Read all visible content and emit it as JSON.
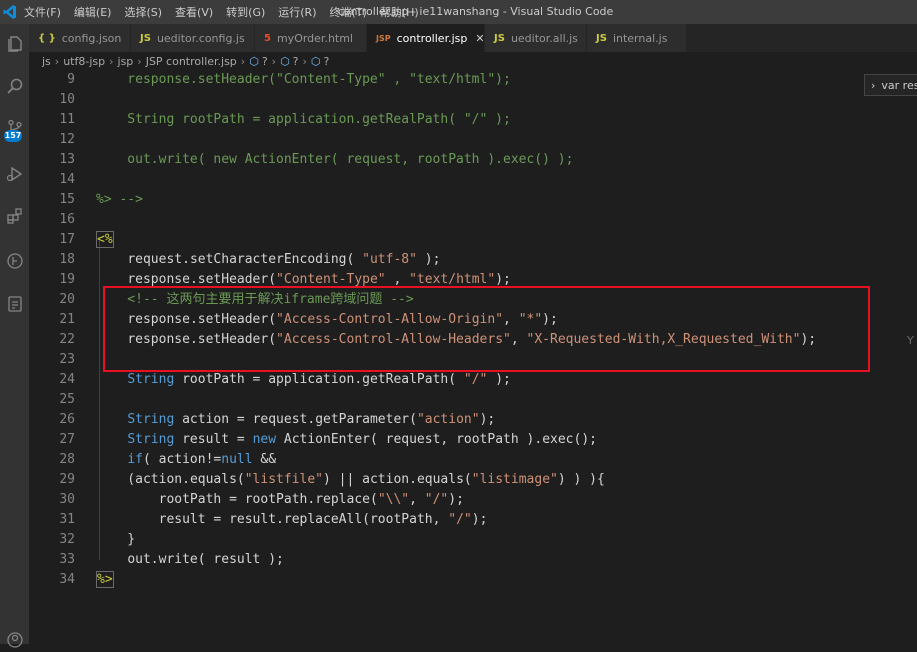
{
  "titlebar": {
    "menu": [
      "文件(F)",
      "编辑(E)",
      "选择(S)",
      "查看(V)",
      "转到(G)",
      "运行(R)",
      "终端(T)",
      "帮助(H)"
    ],
    "window_title": "controller.jsp - ie11wanshang - Visual Studio Code"
  },
  "activity_bar": {
    "icons": [
      "files-icon",
      "search-icon",
      "source-control-icon",
      "run-debug-icon",
      "extensions-icon",
      "timeline-icon",
      "remote-explorer-icon"
    ],
    "scm_badge": "157"
  },
  "tabs": [
    {
      "icon": "{ }",
      "icon_color": "#cbcb41",
      "label": "config.json",
      "active": false
    },
    {
      "icon": "JS",
      "icon_color": "#cbcb41",
      "label": "ueditor.config.js",
      "active": false
    },
    {
      "icon": "5",
      "icon_color": "#e44d26",
      "label": "myOrder.html",
      "active": false
    },
    {
      "icon": "JSP",
      "icon_color": "#d07936",
      "label": "controller.jsp",
      "active": true,
      "close": "✕"
    },
    {
      "icon": "JS",
      "icon_color": "#cbcb41",
      "label": "ueditor.all.js",
      "active": false
    },
    {
      "icon": "JS",
      "icon_color": "#cbcb41",
      "label": "internal.js",
      "active": false
    }
  ],
  "breadcrumb": [
    "js",
    "utf8-jsp",
    "jsp",
    "JSP controller.jsp",
    "?",
    "?",
    "?"
  ],
  "hover_widget": {
    "label": "var res"
  },
  "minimap_marker": "Y",
  "colors": {
    "keyword": "#569cd6",
    "string": "#ce9178",
    "comment": "#6a9955",
    "delim": "#cbcb41",
    "text": "#d4d4d4",
    "highlight_box": "#e81123"
  },
  "code_lines": [
    {
      "n": "9",
      "dim": true,
      "text": "    response.setHeader(\"Content-Type\" , \"text/html\");"
    },
    {
      "n": "10",
      "dim": true,
      "text": ""
    },
    {
      "n": "11",
      "dim": true,
      "text": "    String rootPath = application.getRealPath( \"/\" );"
    },
    {
      "n": "12",
      "dim": true,
      "text": ""
    },
    {
      "n": "13",
      "dim": true,
      "text": "    out.write( new ActionEnter( request, rootPath ).exec() );"
    },
    {
      "n": "14",
      "dim": true,
      "text": ""
    },
    {
      "n": "15",
      "dim": true,
      "text": "%> -->"
    },
    {
      "n": "16",
      "dim": false,
      "text": ""
    },
    {
      "n": "17",
      "dim": false,
      "text": "<%"
    },
    {
      "n": "18",
      "dim": false,
      "text": "    request.setCharacterEncoding( \"utf-8\" );"
    },
    {
      "n": "19",
      "dim": false,
      "text": "    response.setHeader(\"Content-Type\" , \"text/html\");"
    },
    {
      "n": "20",
      "dim": false,
      "text": "    <!-- 这两句主要用于解决iframe跨域问题 -->"
    },
    {
      "n": "21",
      "dim": false,
      "text": "    response.setHeader(\"Access-Control-Allow-Origin\", \"*\");"
    },
    {
      "n": "22",
      "dim": false,
      "text": "    response.setHeader(\"Access-Control-Allow-Headers\", \"X-Requested-With,X_Requested_With\");"
    },
    {
      "n": "23",
      "dim": false,
      "text": ""
    },
    {
      "n": "24",
      "dim": false,
      "text": "    String rootPath = application.getRealPath( \"/\" );"
    },
    {
      "n": "25",
      "dim": false,
      "text": ""
    },
    {
      "n": "26",
      "dim": false,
      "text": "    String action = request.getParameter(\"action\");"
    },
    {
      "n": "27",
      "dim": false,
      "text": "    String result = new ActionEnter( request, rootPath ).exec();"
    },
    {
      "n": "28",
      "dim": false,
      "text": "    if( action!=null &&"
    },
    {
      "n": "29",
      "dim": false,
      "text": "    (action.equals(\"listfile\") || action.equals(\"listimage\") ) ){"
    },
    {
      "n": "30",
      "dim": false,
      "text": "        rootPath = rootPath.replace(\"\\\\\", \"/\");"
    },
    {
      "n": "31",
      "dim": false,
      "text": "        result = result.replaceAll(rootPath, \"/\");"
    },
    {
      "n": "32",
      "dim": false,
      "text": "    }"
    },
    {
      "n": "33",
      "dim": false,
      "text": "    out.write( result );"
    },
    {
      "n": "34",
      "dim": false,
      "text": "%>"
    }
  ]
}
